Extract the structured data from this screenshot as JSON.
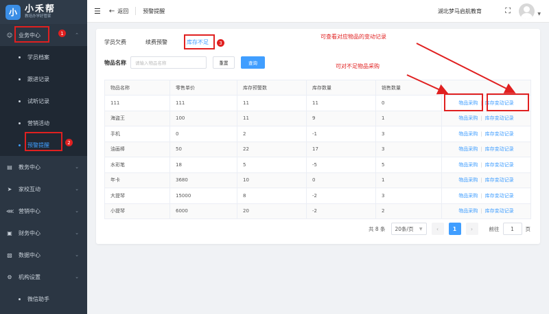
{
  "logo": {
    "badge": "小",
    "title": "小禾帮",
    "subtitle": "教培办学好管家"
  },
  "sidebar": {
    "groups": [
      {
        "label": "业务中心",
        "icon": "user-icon"
      },
      {
        "label": "教务中心",
        "icon": "book-icon"
      },
      {
        "label": "家校互动",
        "icon": "send-icon"
      },
      {
        "label": "营销中心",
        "icon": "share-icon"
      },
      {
        "label": "财务中心",
        "icon": "finance-icon"
      },
      {
        "label": "数据中心",
        "icon": "chart-icon"
      },
      {
        "label": "机构设置",
        "icon": "gear-icon"
      }
    ],
    "sub_items": [
      {
        "label": "学员档案"
      },
      {
        "label": "跟进记录"
      },
      {
        "label": "试听记录"
      },
      {
        "label": "营销活动"
      },
      {
        "label": "预警提醒"
      }
    ],
    "bottom_item": "微信助手"
  },
  "header": {
    "back": "返回",
    "breadcrumb": "预警提醒",
    "org": "湖北梦马启航教育"
  },
  "tabs": [
    "学员欠费",
    "续费预警",
    "库存不足"
  ],
  "filter": {
    "label": "物品名称",
    "placeholder": "请输入物品名称",
    "reset": "重置",
    "query": "查询"
  },
  "table": {
    "columns": [
      "物品名称",
      "零售单价",
      "库存预警数",
      "库存数量",
      "销售数量",
      "操作"
    ],
    "rows": [
      [
        "111",
        "111",
        "11",
        "11",
        "0"
      ],
      [
        "海盗王",
        "100",
        "11",
        "9",
        "1"
      ],
      [
        "手机",
        "0",
        "2",
        "-1",
        "3"
      ],
      [
        "油画棒",
        "50",
        "22",
        "17",
        "3"
      ],
      [
        "水彩笔",
        "18",
        "5",
        "-5",
        "5"
      ],
      [
        "年卡",
        "3680",
        "10",
        "0",
        "1"
      ],
      [
        "大提琴",
        "15000",
        "8",
        "-2",
        "3"
      ],
      [
        "小提琴",
        "6000",
        "20",
        "-2",
        "2"
      ]
    ],
    "op_purchase": "物品采购",
    "op_record": "库存变动记录"
  },
  "pager": {
    "total": "共 8 条",
    "size": "20条/页",
    "page": "1",
    "goto": "前往",
    "goto_value": "1",
    "page_suffix": "页"
  },
  "annotations": {
    "record_note": "可查看对应物品的变动记录",
    "purchase_note": "可对不足物品采购",
    "markers": [
      "1",
      "2",
      "3"
    ]
  }
}
